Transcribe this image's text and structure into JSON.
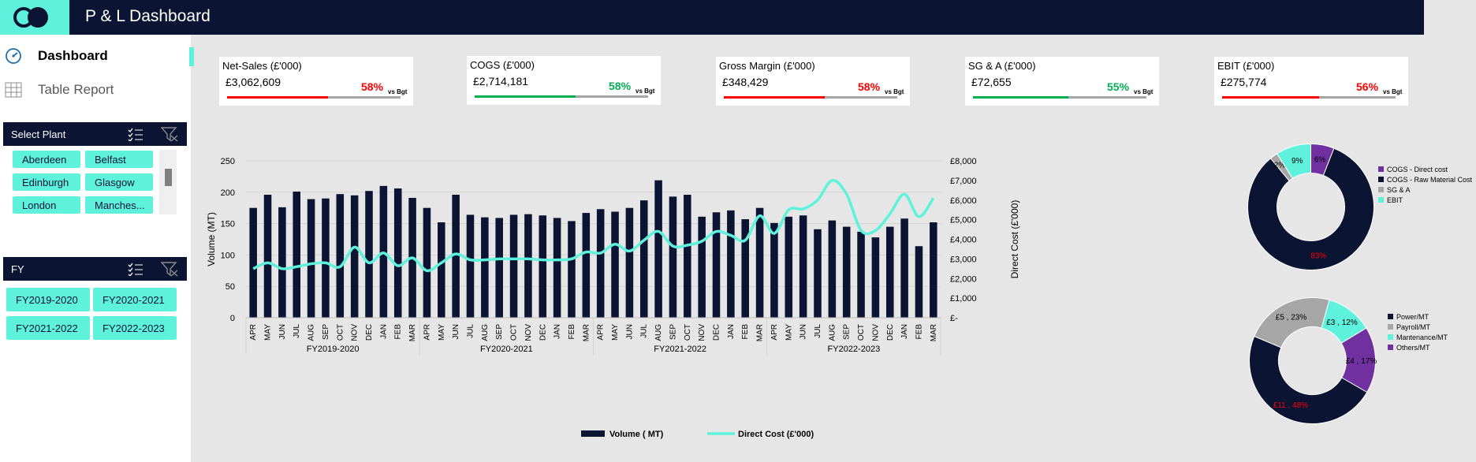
{
  "app": {
    "title": "P & L Dashboard"
  },
  "nav": [
    {
      "label": "Dashboard",
      "icon": "gauge-icon",
      "active": true
    },
    {
      "label": "Table Report",
      "icon": "table-icon",
      "active": false
    }
  ],
  "slicers": {
    "plant": {
      "title": "Select Plant",
      "items": [
        "Aberdeen",
        "Belfast",
        "Edinburgh",
        "Glasgow",
        "London",
        "Manches..."
      ]
    },
    "fy": {
      "title": "FY",
      "items": [
        "FY2019-2020",
        "FY2020-2021",
        "FY2021-2022",
        "FY2022-2023"
      ]
    }
  },
  "kpis": [
    {
      "title": "Net-Sales (£'000)",
      "value": "£3,062,609",
      "pct": "58%",
      "fraction": 0.58,
      "vs": "vs Bgt",
      "status_color": "#ff0000"
    },
    {
      "title": "COGS (£'000)",
      "value": "£2,714,181",
      "pct": "58%",
      "fraction": 0.58,
      "vs": "vs Bgt",
      "status_color": "#00b050"
    },
    {
      "title": "Gross Margin (£'000)",
      "value": "£348,429",
      "pct": "58%",
      "fraction": 0.58,
      "vs": "vs Bgt",
      "status_color": "#ff0000"
    },
    {
      "title": "SG & A (£'000)",
      "value": "£72,655",
      "pct": "55%",
      "fraction": 0.55,
      "vs": "vs Bgt",
      "status_color": "#00b050"
    },
    {
      "title": "EBIT (£'000)",
      "value": "£275,774",
      "pct": "56%",
      "fraction": 0.56,
      "vs": "vs Bgt",
      "status_color": "#ff0000"
    }
  ],
  "chart_data": [
    {
      "type": "bar",
      "months": [
        "APR",
        "MAY",
        "JUN",
        "JUL",
        "AUG",
        "SEP",
        "OCT",
        "NOV",
        "DEC",
        "JAN",
        "FEB",
        "MAR",
        "APR",
        "MAY",
        "JUN",
        "JUL",
        "AUG",
        "SEP",
        "OCT",
        "NOV",
        "DEC",
        "JAN",
        "FEB",
        "MAR",
        "APR",
        "MAY",
        "JUN",
        "JUL",
        "AUG",
        "SEP",
        "OCT",
        "NOV",
        "DEC",
        "JAN",
        "FEB",
        "MAR",
        "APR",
        "MAY",
        "JUN",
        "JUL",
        "AUG",
        "SEP",
        "OCT",
        "NOV",
        "DEC",
        "JAN",
        "FEB",
        "MAR"
      ],
      "groups": [
        "FY2019-2020",
        "FY2020-2021",
        "FY2021-2022",
        "FY2022-2023"
      ],
      "series": [
        {
          "name": "Volume ( MT)",
          "axis": "left",
          "type": "bar",
          "color": "#0b1533",
          "values": [
            175,
            196,
            176,
            201,
            189,
            190,
            197,
            195,
            202,
            210,
            206,
            191,
            175,
            152,
            196,
            164,
            160,
            159,
            164,
            165,
            163,
            159,
            154,
            167,
            173,
            169,
            175,
            187,
            219,
            193,
            196,
            161,
            168,
            171,
            157,
            175,
            151,
            161,
            163,
            141,
            155,
            145,
            137,
            128,
            145,
            158,
            114,
            152
          ]
        },
        {
          "name": "Direct Cost (£'000)",
          "axis": "right",
          "type": "line",
          "color": "#5ef2dc",
          "values": [
            2500,
            2800,
            2500,
            2600,
            2750,
            2800,
            2600,
            3600,
            2800,
            3300,
            2650,
            3050,
            2400,
            2800,
            3250,
            2950,
            2950,
            3000,
            3000,
            3000,
            2950,
            2950,
            3000,
            3350,
            3300,
            3750,
            3400,
            3950,
            4400,
            3650,
            3700,
            3900,
            4400,
            4200,
            3950,
            5200,
            4300,
            5500,
            5550,
            6000,
            7000,
            6300,
            4450,
            4450,
            5300,
            6300,
            5150,
            6100
          ]
        }
      ],
      "y_left": {
        "label": "Volume (MT)",
        "min": 0,
        "max": 250,
        "ticks": [
          "0",
          "50",
          "100",
          "150",
          "200",
          "250"
        ]
      },
      "y_right": {
        "label": "Direct Cost (£'000)",
        "min": 0,
        "max": 8000,
        "ticks": [
          "£-",
          "£1,000",
          "£2,000",
          "£3,000",
          "£4,000",
          "£5,000",
          "£6,000",
          "£7,000",
          "£8,000"
        ]
      },
      "grid": true,
      "legend": "bottom"
    },
    {
      "type": "pie",
      "donut": true,
      "slices": [
        {
          "name": "COGS - Direct cost",
          "value": 6,
          "label": "6%",
          "color": "#7030a0",
          "label_color": "#000000"
        },
        {
          "name": "COGS - Raw Material Cost",
          "value": 83,
          "label": "83%",
          "color": "#0b1533",
          "label_color": "#ff0000"
        },
        {
          "name": "SG & A",
          "value": 2,
          "label": "2%",
          "color": "#a6a6a6",
          "label_color": "#000000"
        },
        {
          "name": "EBIT",
          "value": 9,
          "label": "9%",
          "color": "#5ef2dc",
          "label_color": "#000000"
        }
      ],
      "legend": "right"
    },
    {
      "type": "pie",
      "donut": true,
      "slices": [
        {
          "name": "Power/MT",
          "value": 48,
          "label": "£11 , 48%",
          "color": "#0b1533",
          "label_color": "#ff0000"
        },
        {
          "name": "Payroll/MT",
          "value": 23,
          "label": "£5 , 23%",
          "color": "#a6a6a6",
          "label_color": "#000000"
        },
        {
          "name": "Mantenance/MT",
          "value": 12,
          "label": "£3 , 12%",
          "color": "#5ef2dc",
          "label_color": "#000000"
        },
        {
          "name": "Others/MT",
          "value": 17,
          "label": "£4 , 17%",
          "color": "#7030a0",
          "label_color": "#000000"
        }
      ],
      "legend": "right"
    }
  ]
}
